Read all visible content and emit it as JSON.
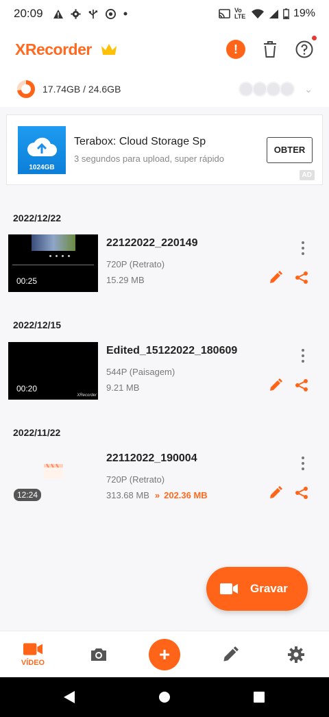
{
  "status_bar": {
    "time": "20:09",
    "left_icons": [
      "warning-icon",
      "settings-icon",
      "usb-icon",
      "chrome-icon",
      "dot-icon"
    ],
    "network_label": "Vo LTE",
    "battery": "19%"
  },
  "app_bar": {
    "logo": "XRecorder",
    "colors": {
      "accent": "#ff6418",
      "crown": "#ffc107"
    }
  },
  "storage": {
    "text": "17.74GB / 24.6GB",
    "used_fraction": 0.72
  },
  "ad": {
    "thumb_label": "1024GB",
    "title": "Terabox: Cloud Storage Sp",
    "subtitle": "3 segundos para upload, super rápido",
    "cta": "OBTER",
    "badge": "AD"
  },
  "videos": [
    {
      "date": "2022/12/22",
      "title": "22122022_220149",
      "resolution": "720P (Retrato)",
      "size": "15.29 MB",
      "duration": "00:25"
    },
    {
      "date": "2022/12/15",
      "title": "Edited_15122022_180609",
      "resolution": "544P (Paisagem)",
      "size": "9.21 MB",
      "duration": "00:20",
      "watermark": "XRecorder"
    },
    {
      "date": "2022/11/22",
      "title": "22112022_190004",
      "resolution": "720P (Retrato)",
      "size": "313.68 MB",
      "compressed_arrow": "»",
      "compressed_size": "202.36 MB",
      "duration": "12:24"
    }
  ],
  "record_button": {
    "label": "Gravar"
  },
  "bottom_nav": {
    "items": [
      {
        "icon": "video-icon",
        "label": "VÍDEO",
        "active": true
      },
      {
        "icon": "camera-icon"
      },
      {
        "icon": "plus-icon"
      },
      {
        "icon": "pencil-icon"
      },
      {
        "icon": "gear-icon"
      }
    ]
  }
}
